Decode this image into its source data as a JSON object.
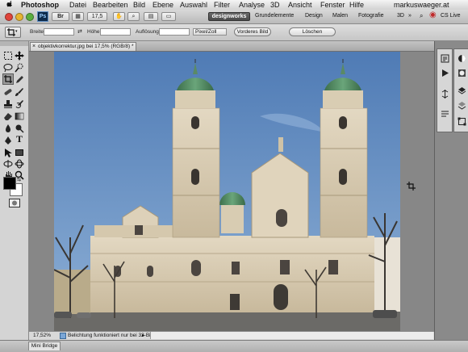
{
  "menubar": {
    "app_name": "Photoshop",
    "items": [
      "Datei",
      "Bearbeiten",
      "Bild",
      "Ebene",
      "Auswahl",
      "Filter",
      "Analyse",
      "3D",
      "Ansicht",
      "Fenster",
      "Hilfe"
    ],
    "right_text": "markuswaeger.at"
  },
  "appbar": {
    "ps_logo": "Ps",
    "zoom_value": "17,5",
    "workspace_active": "designworks",
    "workspaces": [
      "Grundelemente",
      "Design",
      "Malen",
      "Fotografie",
      "3D"
    ],
    "cs_live": "CS Live"
  },
  "options": {
    "breite_label": "Breite:",
    "hoehe_label": "Höhe:",
    "aufloesung_label": "Auflösung:",
    "unit_value": "Pixel/Zoll",
    "front_image_button": "Vorderes Bild",
    "clear_button": "Löschen"
  },
  "document": {
    "tab_title": "objektivkorrektur.jpg bei 17,5% (RGB/8) *"
  },
  "status": {
    "zoom": "17,52%",
    "message": "Belichtung funktioniert nur bei 32-Bit"
  },
  "minibridge": {
    "label": "Mini Bridge"
  },
  "colors": {
    "sky_top": "#4f7bb5",
    "sky_bottom": "#8eb0d6",
    "facade": "#d9cdb5",
    "dome": "#4f8a5f",
    "app_chrome": "#7d7d7d"
  },
  "icons": {
    "tools": [
      "move-tool",
      "marquee-tool",
      "lasso-tool",
      "quick-selection-tool",
      "crop-tool",
      "eyedropper-tool",
      "spot-healing-tool",
      "brush-tool",
      "clone-stamp-tool",
      "history-brush-tool",
      "eraser-tool",
      "gradient-tool",
      "blur-tool",
      "dodge-tool",
      "pen-tool",
      "type-tool",
      "path-selection-tool",
      "shape-tool",
      "3d-rotate-tool",
      "3d-orbit-tool",
      "hand-tool",
      "zoom-tool"
    ],
    "panel_col1": [
      "history-icon",
      "actions-icon",
      "navigator-icon",
      "paragraph-icon"
    ],
    "panel_col2": [
      "adjustments-icon",
      "masks-icon",
      "layers-icon",
      "channels-icon",
      "paths-icon"
    ]
  }
}
